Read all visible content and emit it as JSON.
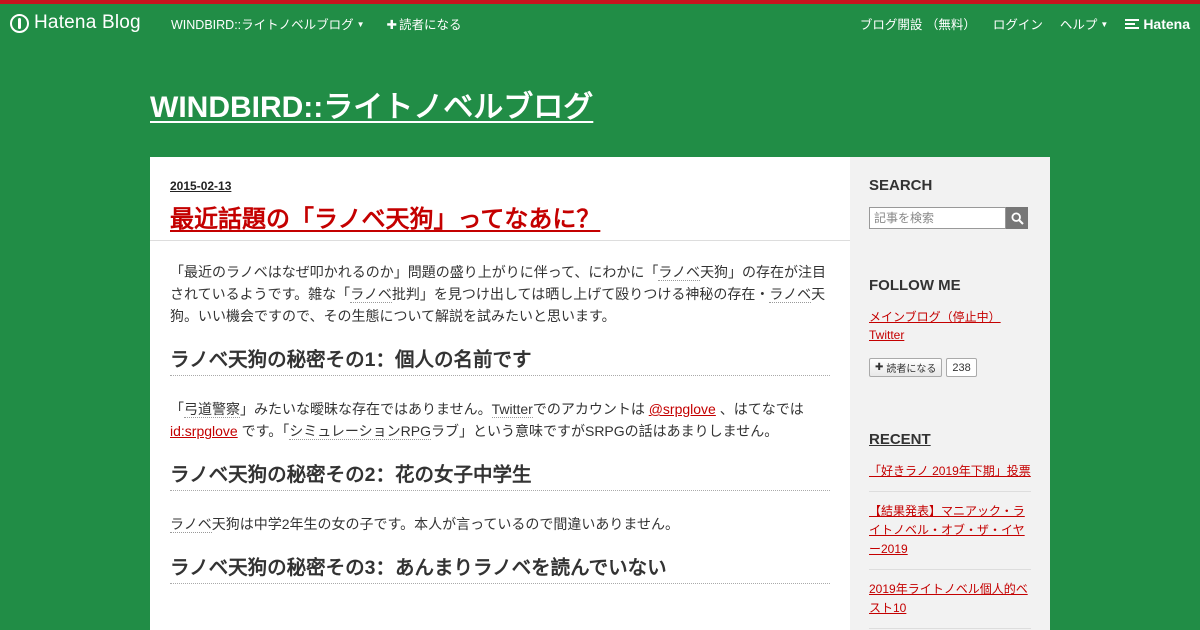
{
  "topbar": {
    "logo_text": "Hatena Blog",
    "blog_menu_label": "WINDBIRD::ライトノベルブログ",
    "subscribe_label": "読者になる",
    "open_blog_label": "ブログ開設 （無料）",
    "login_label": "ログイン",
    "help_label": "ヘルプ",
    "hatena_label": "Hatena",
    "accent_color": "#c9131e"
  },
  "blog": {
    "title": "WINDBIRD::ライトノベルブログ",
    "background_color": "#218d46"
  },
  "entry": {
    "date": "2015-02-13",
    "title": "最近話題の「ラノベ天狗」ってなあに？",
    "intro_1": "「最近のラノベはなぜ叩かれるのか」問題の盛り上がりに伴って、にわかに「",
    "intro_kw1": "ラノベ",
    "intro_2": "天狗」の存在が注目されているようです。雑な「",
    "intro_kw2": "ラノベ",
    "intro_3": "批判」を見つけ出しては晒し上げて殴りつける神秘の存在・",
    "intro_kw3": "ラノベ",
    "intro_4": "天狗。いい機会ですので、その生態について解説を試みたいと思います。",
    "h1": "ラノベ天狗の秘密その1：個人の名前です",
    "p1_a": "「",
    "p1_kw1": "弓道警察",
    "p1_b": "」みたいな曖昧な存在ではありません。",
    "p1_kw2": "Twitter",
    "p1_c": "でのアカウントは ",
    "p1_link1": "@srpglove",
    "p1_d": " 、はてなでは ",
    "p1_link2": "id:srpglove",
    "p1_e": " です。「",
    "p1_kw3": "シミュレーションRPG",
    "p1_f": "ラブ」という意味ですがSRPGの話はあまりしません。",
    "h2": "ラノベ天狗の秘密その2：花の女子中学生",
    "p2_kw": "ラノベ",
    "p2": "天狗は中学2年生の女の子です。本人が言っているので間違いありません。",
    "h3": "ラノベ天狗の秘密その3：あんまりラノベを読んでいない"
  },
  "sidebar": {
    "search_title": "SEARCH",
    "search_placeholder": "記事を検索",
    "follow_title": "FOLLOW ME",
    "follow_link1": "メインブログ（停止中）",
    "follow_link2": "Twitter",
    "reader_button": "読者になる",
    "reader_count": "238",
    "recent_title": "RECENT",
    "recent": [
      "「好きラノ 2019年下期」投票",
      "【結果発表】マニアック・ライトノベル・オブ・ザ・イヤー2019",
      "2019年ライトノベル個人的ベスト10"
    ]
  }
}
